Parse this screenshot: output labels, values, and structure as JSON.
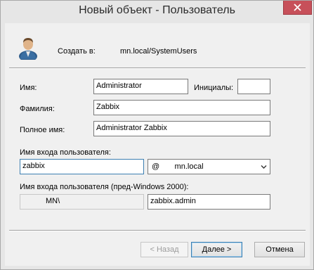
{
  "window": {
    "title": "Новый объект - Пользователь"
  },
  "header": {
    "create_in_label": "Создать в:",
    "create_in_value": "mn.local/SystemUsers"
  },
  "form": {
    "first_name_label": "Имя:",
    "first_name_value": "Administrator",
    "initials_label": "Инициалы:",
    "initials_value": "",
    "last_name_label": "Фамилия:",
    "last_name_value": "Zabbix",
    "full_name_label": "Полное имя:",
    "full_name_value": "Administrator Zabbix",
    "logon_label": "Имя входа пользователя:",
    "logon_value": "zabbix",
    "domain_value": "@       mn.local",
    "pre2000_label": "Имя входа пользователя (пред-Windows 2000):",
    "pre2000_domain": "MN\\",
    "pre2000_value": "zabbix.admin"
  },
  "buttons": {
    "back": "< Назад",
    "next": "Далее >",
    "cancel": "Отмена"
  }
}
